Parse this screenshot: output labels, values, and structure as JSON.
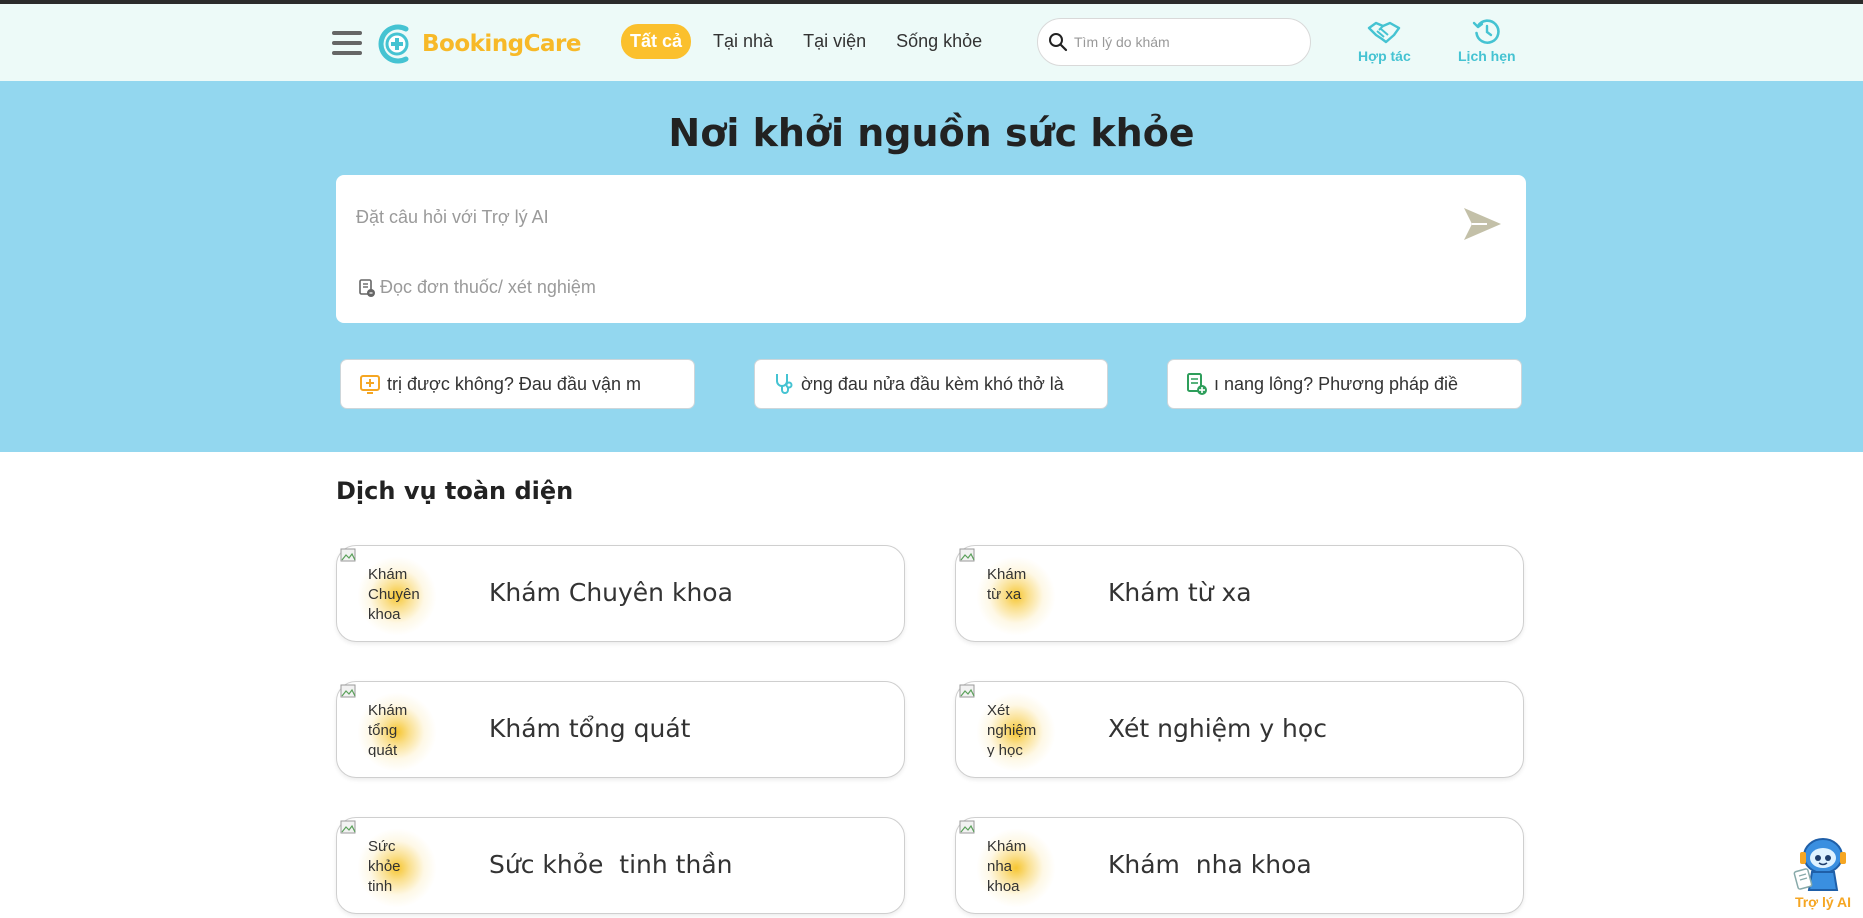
{
  "header": {
    "logo_text": "BookingCare",
    "tabs": [
      {
        "label": "Tất cả",
        "active": true
      },
      {
        "label": "Tại nhà",
        "active": false
      },
      {
        "label": "Tại viện",
        "active": false
      },
      {
        "label": "Sống khỏe",
        "active": false
      }
    ],
    "search_placeholder": "Tìm lý do khám",
    "partner_label": "Hợp tác",
    "appointments_label": "Lịch hẹn"
  },
  "hero": {
    "title": "Nơi khởi nguồn sức khỏe",
    "ai_placeholder": "Đặt câu hỏi với Trợ lý AI",
    "read_prescription": "Đọc đơn thuốc/ xét nghiệm",
    "suggestions": [
      {
        "text": "trị được không?    Đau đầu vận m",
        "icon": "plus-box-icon"
      },
      {
        "text": "ờng đau nửa đầu kèm khó thở là",
        "icon": "stethoscope-icon"
      },
      {
        "text": "ı nang lông?    Phương pháp điề",
        "icon": "document-plus-icon"
      }
    ]
  },
  "services": {
    "title": "Dịch vụ toàn diện",
    "items": [
      {
        "name": "Khám Chuyên khoa",
        "alt": "Khám Chuyên khoa"
      },
      {
        "name": "Khám từ xa",
        "alt": "Khám từ xa"
      },
      {
        "name": "Khám tổng quát",
        "alt": "Khám tổng quát"
      },
      {
        "name": "Xét nghiệm y học",
        "alt": "Xét nghiệm y học"
      },
      {
        "name": "Sức khỏe  tinh thần",
        "alt": "Sức khỏe tinh thần"
      },
      {
        "name": "Khám  nha khoa",
        "alt": "Khám nha khoa"
      }
    ]
  },
  "assistant": {
    "label": "Trợ lý AI"
  },
  "colors": {
    "brand_yellow": "#fbc02d",
    "brand_teal": "#45c3d2",
    "hero_bg": "#93d7ef",
    "header_bg": "#edfaf8"
  }
}
